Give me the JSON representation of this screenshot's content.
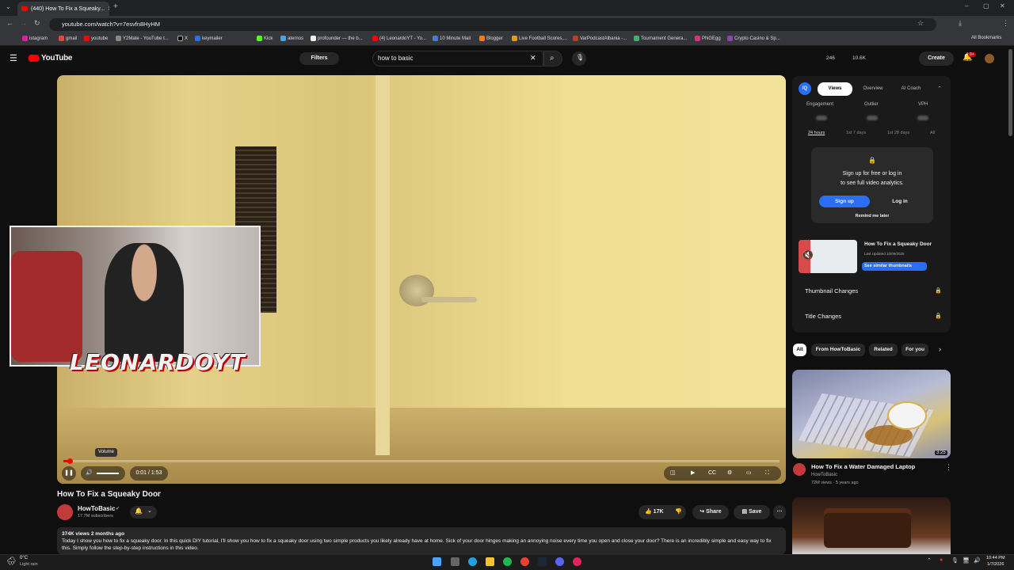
{
  "browser": {
    "tab_title": "(440) How To Fix a Squeaky...",
    "url": "youtube.com/watch?v=7esvfn8HyHM",
    "bookmarks": [
      "istagram",
      "gmail",
      "youtube",
      "Y2Mate - YouTube t...",
      "X",
      "keymailer",
      "Kick",
      "aternos",
      "profounder — the b...",
      "(4) LeonardoYT - Yo...",
      "10 Minute Mail",
      "Blogger",
      "Live Football Scores,...",
      "VarPodcastAlbania -...",
      "Tournament Genera...",
      "PNGEgg",
      "Crypto Casino & Sp..."
    ],
    "all_bookmarks": "All Bookmarks"
  },
  "youtube": {
    "logo_text": "YouTube",
    "filters_label": "Filters",
    "search_value": "how to basic",
    "stats": [
      "246",
      "10.6K"
    ],
    "create_label": "Create",
    "notifications_badge": "9+"
  },
  "player": {
    "time": "0:01 / 1:53",
    "volume_tooltip": "Volume",
    "progress": 0.009
  },
  "webcam": {
    "overlay_text": "LEONARDOYT"
  },
  "video": {
    "title": "How To Fix a Squeaky Door",
    "channel": "HowToBasic",
    "subscribers": "17.7M subscribers",
    "likes": "17K",
    "share_label": "Share",
    "save_label": "Save",
    "meta": "374K views  2 months ago",
    "description": "Today I show you how to fix a squeaky door. In this quick DIY tutorial, I'll show you how to fix a squeaky door using two simple products you likely already have at home. Sick of your door hinges making an annoying noise every time you open and close your door? There is an incredibly simple and easy way to fix this. Simply follow the step-by-step instructions in this video."
  },
  "panel": {
    "tabs": [
      "Views",
      "Overview",
      "AI Coach"
    ],
    "metrics": [
      "Engagement",
      "Outlier",
      "VPH"
    ],
    "ranges": [
      "24 hours",
      "1st 7 days",
      "1st 28 days",
      "All"
    ],
    "lock_text_1": "Sign up for free or log in",
    "lock_text_2": "to see full video analytics.",
    "signup": "Sign up",
    "login": "Log in",
    "remind": "Remind me later",
    "thumb_title": "How To Fix a Squeaky Door",
    "thumb_updated": "Last Updated 10/09/2025",
    "similar": "See similar thumbnails",
    "thumbnail_changes": "Thumbnail Changes",
    "title_changes": "Title Changes"
  },
  "chips": [
    "All",
    "From HowToBasic",
    "Related",
    "For you"
  ],
  "recommendations": [
    {
      "title": "How To Fix a Water Damaged Laptop",
      "channel": "HowToBasic",
      "meta": "72M views · 5 years ago",
      "duration": "3:25"
    }
  ],
  "taskbar": {
    "weather_temp": "0°C",
    "weather_desc": "Light rain",
    "time": "10:44 PM",
    "date": "1/7/2026"
  }
}
